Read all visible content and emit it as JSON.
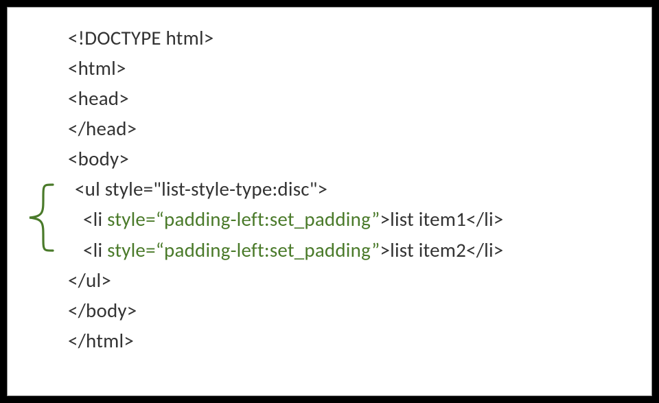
{
  "code": {
    "l1": "<!DOCTYPE html>",
    "l2": "<html>",
    "l3": "<head>",
    "l4": "</head>",
    "l5": "<body>",
    "l6": "<ul style=\"list-style-type:disc\">",
    "l7a": "<li ",
    "l7h": "style=“padding-left:set_padding”",
    "l7b": ">list item1</li>",
    "l8a": "<li ",
    "l8h": "style=“padding-left:set_padding”",
    "l8b": ">list item2</li>",
    "l9": "</ul>",
    "l10": "</body>",
    "l11": "</html>"
  }
}
